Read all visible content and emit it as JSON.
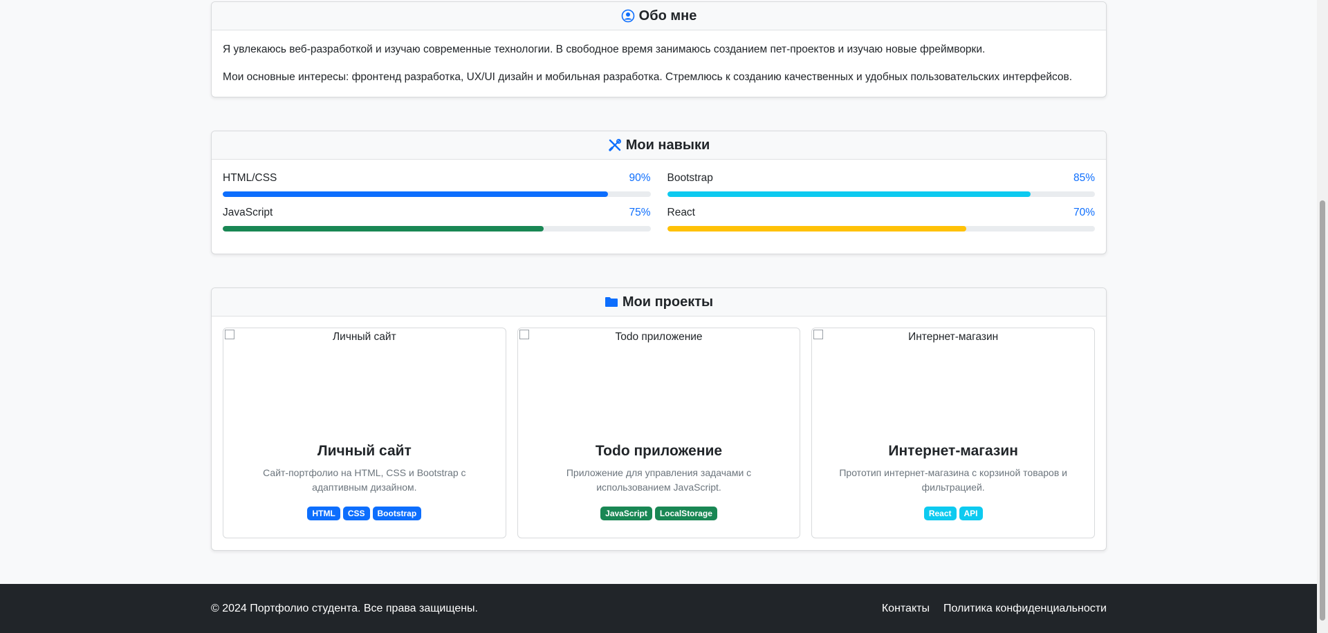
{
  "about": {
    "title": "Обо мне",
    "icon": "user-circle-icon",
    "p1": "Я увлекаюсь веб-разработкой и изучаю современные технологии. В свободное время занимаюсь созданием пет-проектов и изучаю новые фреймворки.",
    "p2": "Мои основные интересы: фронтенд разработка, UX/UI дизайн и мобильная разработка. Стремлюсь к созданию качественных и удобных пользовательских интерфейсов."
  },
  "skills": {
    "title": "Мои навыки",
    "icon": "tools-icon",
    "items": [
      {
        "name": "HTML/CSS",
        "percent_label": "90%",
        "level": 90,
        "color": "#0d6efd"
      },
      {
        "name": "Bootstrap",
        "percent_label": "85%",
        "level": 85,
        "color": "#0dcaf0"
      },
      {
        "name": "JavaScript",
        "percent_label": "75%",
        "level": 75,
        "color": "#198754"
      },
      {
        "name": "React",
        "percent_label": "70%",
        "level": 70,
        "color": "#ffc107"
      }
    ]
  },
  "projects": {
    "title": "Мои проекты",
    "icon": "folder-icon",
    "items": [
      {
        "image_alt": "Личный сайт",
        "title": "Личный сайт",
        "description": "Сайт-портфолио на HTML, CSS и Bootstrap с адаптивным дизайном.",
        "tags": [
          "HTML",
          "CSS",
          "Bootstrap"
        ],
        "tag_color": "#0d6efd"
      },
      {
        "image_alt": "Todo приложение",
        "title": "Todo приложение",
        "description": "Приложение для управления задачами с использованием JavaScript.",
        "tags": [
          "JavaScript",
          "LocalStorage"
        ],
        "tag_color": "#198754"
      },
      {
        "image_alt": "Интернет-магазин",
        "title": "Интернет-магазин",
        "description": "Прототип интернет-магазина с корзиной товаров и фильтрацией.",
        "tags": [
          "React",
          "API"
        ],
        "tag_color": "#0dcaf0"
      }
    ]
  },
  "footer": {
    "copyright": "© 2024 Портфолио студента. Все права защищены.",
    "links": [
      "Контакты",
      "Политика конфиденциальности"
    ]
  }
}
